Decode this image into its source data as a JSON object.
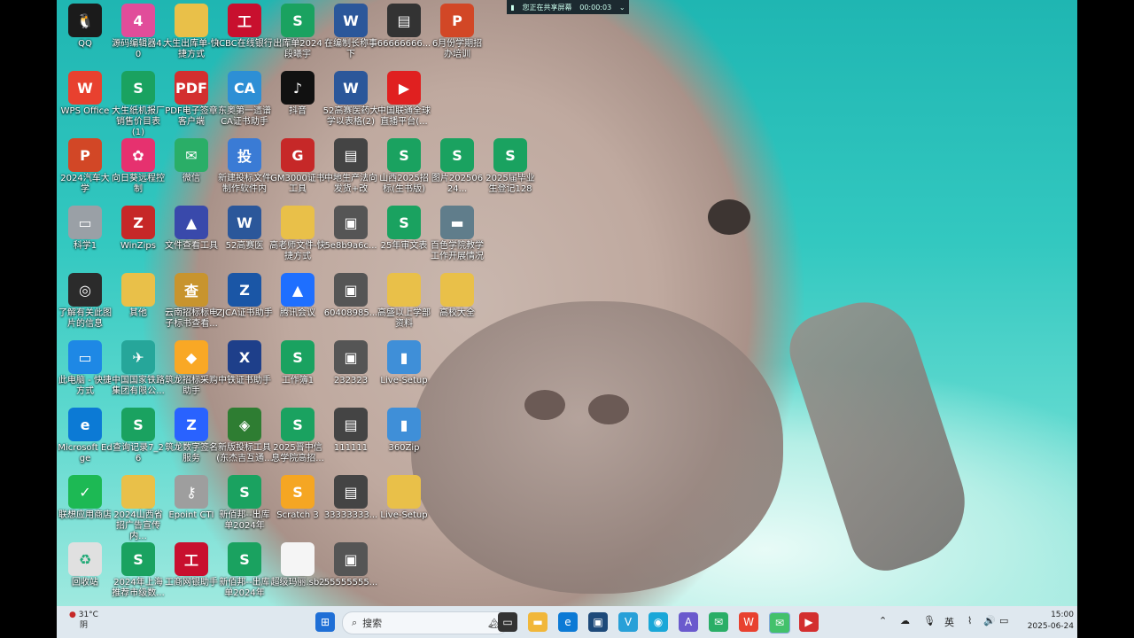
{
  "recording_bar": {
    "status": "您正在共享屏幕",
    "time": "00:00:03"
  },
  "colors": {
    "taskbar": "#dfe8ef",
    "water": "#33c8c0"
  },
  "desktop_icons": [
    {
      "label": "QQ",
      "icon": "qq-penguin-icon",
      "color": "#1b1b1b",
      "glyph": "🐧"
    },
    {
      "label": "源码编辑器4.0",
      "icon": "code-editor-icon",
      "color": "#e14d9a",
      "glyph": "4"
    },
    {
      "label": "大生出库单-快捷方式",
      "icon": "folder-icon",
      "color": "#e9c049",
      "glyph": ""
    },
    {
      "label": "ICBC在线银行",
      "icon": "icbc-icon",
      "color": "#c8102e",
      "glyph": "工"
    },
    {
      "label": "出库单2024 段曦宇",
      "icon": "sheet-icon",
      "color": "#1aa260",
      "glyph": "S"
    },
    {
      "label": "在编制长称事下",
      "icon": "word-icon",
      "color": "#2b579a",
      "glyph": "W"
    },
    {
      "label": "66666666...",
      "icon": "video-file-icon",
      "color": "#333",
      "glyph": "▤"
    },
    {
      "label": "6月份学期招办培训",
      "icon": "ppt-icon",
      "color": "#d24726",
      "glyph": "P"
    },
    {
      "label": "WPS Office",
      "icon": "wps-icon",
      "color": "#e8412f",
      "glyph": "W"
    },
    {
      "label": "大生纸机报厂销售价目表(1)",
      "icon": "sheet-icon",
      "color": "#1aa260",
      "glyph": "S"
    },
    {
      "label": "PDF电子签章客户端",
      "icon": "pdf-icon",
      "color": "#d32f2f",
      "glyph": "PDF"
    },
    {
      "label": "东奥第一遗谱CA证书助手",
      "icon": "ca-icon",
      "color": "#2d8fd5",
      "glyph": "CA"
    },
    {
      "label": "抖音",
      "icon": "tiktok-icon",
      "color": "#111",
      "glyph": "♪"
    },
    {
      "label": "52高赛医药大学以表格(2)",
      "icon": "word-icon",
      "color": "#2b579a",
      "glyph": "W"
    },
    {
      "label": "中国联通全球直播平台(...",
      "icon": "live-icon",
      "color": "#e02020",
      "glyph": "▶"
    },
    {
      "label": "2024汽车大学",
      "icon": "ppt-icon",
      "color": "#d24726",
      "glyph": "P"
    },
    {
      "label": "向日葵远程控制",
      "icon": "sunflower-icon",
      "color": "#e6316f",
      "glyph": "✿"
    },
    {
      "label": "微信",
      "icon": "wechat-icon",
      "color": "#2aae67",
      "glyph": "✉"
    },
    {
      "label": "新建投标文件制作软件内",
      "icon": "bid-icon",
      "color": "#3a7bd5",
      "glyph": "投"
    },
    {
      "label": "GM3000证书工具",
      "icon": "gm-icon",
      "color": "#c62828",
      "glyph": "G"
    },
    {
      "label": "中地生产法向发货+改",
      "icon": "video-file-icon",
      "color": "#444",
      "glyph": "▤"
    },
    {
      "label": "山西2025招标(生书版)",
      "icon": "sheet-icon",
      "color": "#1aa260",
      "glyph": "S"
    },
    {
      "label": "图片20250624...",
      "icon": "sheet-icon",
      "color": "#1aa260",
      "glyph": "S"
    },
    {
      "label": "2025届毕业生登记128",
      "icon": "sheet-icon",
      "color": "#1aa260",
      "glyph": "S"
    },
    {
      "label": "科学1",
      "icon": "app-icon",
      "color": "#9aa0a6",
      "glyph": "▭"
    },
    {
      "label": "WinZips",
      "icon": "winzip-icon",
      "color": "#c62828",
      "glyph": "Z"
    },
    {
      "label": "文件查看工具",
      "icon": "viewer-icon",
      "color": "#3949ab",
      "glyph": "▲"
    },
    {
      "label": "52高赛医",
      "icon": "word-icon",
      "color": "#2b579a",
      "glyph": "W"
    },
    {
      "label": "高老师文件-快捷方式",
      "icon": "folder-icon",
      "color": "#e9c049",
      "glyph": ""
    },
    {
      "label": "5e8b9a6c...",
      "icon": "image-file-icon",
      "color": "#555",
      "glyph": "▣"
    },
    {
      "label": "25年审文表",
      "icon": "sheet-icon",
      "color": "#1aa260",
      "glyph": "S"
    },
    {
      "label": "百色学院教学工作开展情况",
      "icon": "app-icon",
      "color": "#607d8b",
      "glyph": "▬"
    },
    {
      "label": "了解有关此图片的信息",
      "icon": "info-camera-icon",
      "color": "#2b2b2b",
      "glyph": "◎"
    },
    {
      "label": "其他",
      "icon": "folder-icon",
      "color": "#e9c049",
      "glyph": ""
    },
    {
      "label": "云南招标标电子标书查看...",
      "icon": "search-stamp-icon",
      "color": "#c8942e",
      "glyph": "查"
    },
    {
      "label": "ZJCA证书助手",
      "icon": "zjca-icon",
      "color": "#1a56a6",
      "glyph": "Z"
    },
    {
      "label": "腾讯会议",
      "icon": "tencent-meeting-icon",
      "color": "#1e6fff",
      "glyph": "▲"
    },
    {
      "label": "60408985...",
      "icon": "image-file-icon",
      "color": "#555",
      "glyph": "▣"
    },
    {
      "label": "高盛以上学部资料",
      "icon": "folder-icon",
      "color": "#e9c049",
      "glyph": ""
    },
    {
      "label": "高校大全",
      "icon": "folder-icon",
      "color": "#e9c049",
      "glyph": ""
    },
    {
      "label": "此电脑 - 快捷方式",
      "icon": "computer-icon",
      "color": "#1e88e5",
      "glyph": "▭"
    },
    {
      "label": "中国国家铁路集团有限公...",
      "icon": "railway-icon",
      "color": "#26a69a",
      "glyph": "✈"
    },
    {
      "label": "筑龙招标采购助手",
      "icon": "bid-icon",
      "color": "#f9a825",
      "glyph": "◆"
    },
    {
      "label": "中铁证书助手",
      "icon": "cert-icon",
      "color": "#1e3f8a",
      "glyph": "X"
    },
    {
      "label": "工作簿1",
      "icon": "sheet-icon",
      "color": "#1aa260",
      "glyph": "S"
    },
    {
      "label": "232323",
      "icon": "image-file-icon",
      "color": "#555",
      "glyph": "▣"
    },
    {
      "label": "Live-Setup",
      "icon": "installer-icon",
      "color": "#3f8fd8",
      "glyph": "▮"
    },
    {
      "label": "Microsoft Edge",
      "icon": "edge-icon",
      "color": "#0c7ad5",
      "glyph": "e"
    },
    {
      "label": "查询记录7_26",
      "icon": "sheet-icon",
      "color": "#1aa260",
      "glyph": "S"
    },
    {
      "label": "筑龙数字签名服务",
      "icon": "sign-icon",
      "color": "#2962ff",
      "glyph": "Z"
    },
    {
      "label": "新版投标工具(东杰吉互通...",
      "icon": "shield-icon",
      "color": "#2e7d32",
      "glyph": "◈"
    },
    {
      "label": "2025晋中信息学院高招...",
      "icon": "sheet-icon",
      "color": "#1aa260",
      "glyph": "S"
    },
    {
      "label": "111111",
      "icon": "video-file-icon",
      "color": "#444",
      "glyph": "▤"
    },
    {
      "label": "360Zip",
      "icon": "installer-icon",
      "color": "#3f8fd8",
      "glyph": "▮"
    },
    {
      "label": "联想应用商店",
      "icon": "store-icon",
      "color": "#1db954",
      "glyph": "✓"
    },
    {
      "label": "2024山西省招广告宣传内...",
      "icon": "folder-icon",
      "color": "#e9c049",
      "glyph": ""
    },
    {
      "label": "Epoint CTI",
      "icon": "keys-icon",
      "color": "#9e9e9e",
      "glyph": "⚷"
    },
    {
      "label": "新佰邦--出库单2024年",
      "icon": "sheet-icon",
      "color": "#1aa260",
      "glyph": "S"
    },
    {
      "label": "Scratch 3",
      "icon": "scratch-icon",
      "color": "#f5a623",
      "glyph": "S"
    },
    {
      "label": "33333333...",
      "icon": "video-file-icon",
      "color": "#444",
      "glyph": "▤"
    },
    {
      "label": "Live-Setup",
      "icon": "folder-icon",
      "color": "#e9c049",
      "glyph": ""
    },
    {
      "label": "回收站",
      "icon": "recycle-bin-icon",
      "color": "#e0e0e0",
      "glyph": "♻"
    },
    {
      "label": "2024年上海推荐市级数...",
      "icon": "sheet-icon",
      "color": "#1aa260",
      "glyph": "S"
    },
    {
      "label": "工商网银助手",
      "icon": "icbc-icon",
      "color": "#c8102e",
      "glyph": "工"
    },
    {
      "label": "新佰邦--出库单2024年",
      "icon": "sheet-icon",
      "color": "#1aa260",
      "glyph": "S"
    },
    {
      "label": "超级玛丽.sb2",
      "icon": "file-icon",
      "color": "#f5f5f5",
      "glyph": ""
    },
    {
      "label": "55555555...",
      "icon": "image-file-icon",
      "color": "#555",
      "glyph": "▣"
    }
  ],
  "taskbar": {
    "weather_temp": "31°C",
    "weather_desc": "阴",
    "search_placeholder": "搜索",
    "ime": "英",
    "time": "15:00",
    "date": "2025-06-24"
  }
}
